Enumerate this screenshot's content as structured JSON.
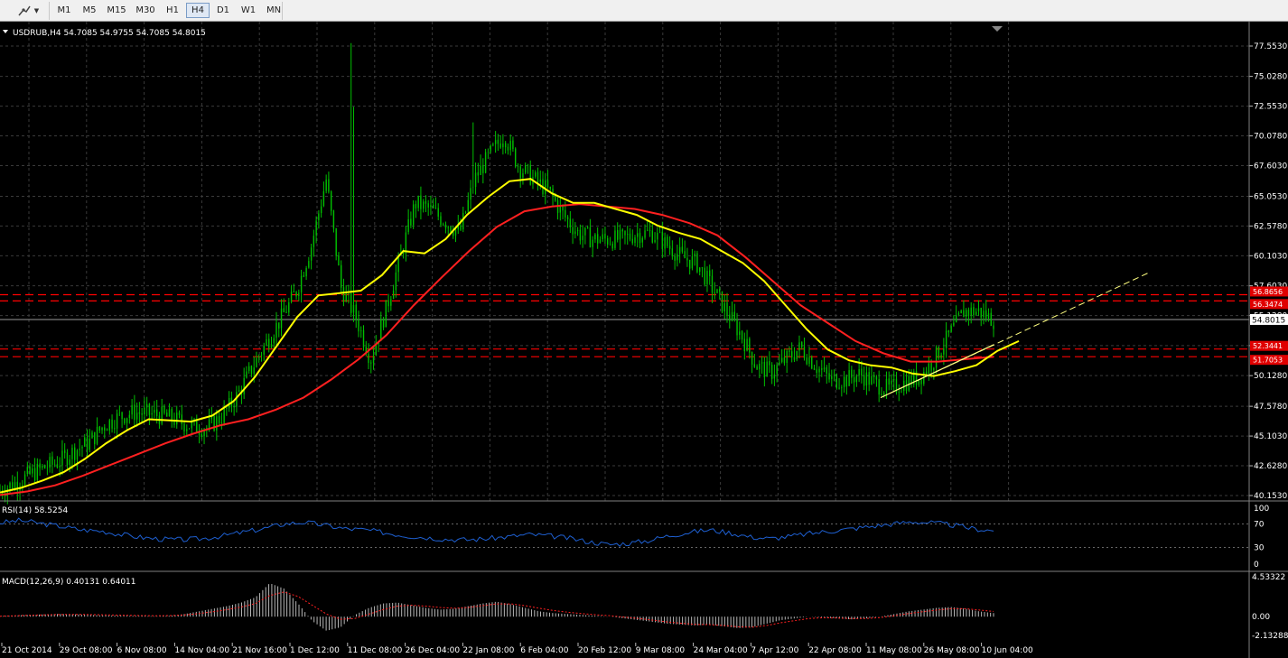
{
  "toolbar": {
    "tool_icon": "line-tool-icon",
    "timeframes": [
      {
        "label": "M1",
        "active": false
      },
      {
        "label": "M5",
        "active": false
      },
      {
        "label": "M15",
        "active": false
      },
      {
        "label": "M30",
        "active": false
      },
      {
        "label": "H1",
        "active": false
      },
      {
        "label": "H4",
        "active": true
      },
      {
        "label": "D1",
        "active": false
      },
      {
        "label": "W1",
        "active": false
      },
      {
        "label": "MN",
        "active": false
      }
    ]
  },
  "colors": {
    "background": "#000000",
    "grid": "#3a3a3a",
    "candles": "#00c000",
    "ma_fast": "#ffff00",
    "ma_slow": "#ff2020",
    "level_lines": "#ff0000",
    "rsi": "#1e5fd0",
    "macd_hist": "#b8b8b8",
    "macd_signal": "#ff2020",
    "trendline": "#ffff80"
  },
  "chart_data": [
    {
      "type": "candlestick",
      "title": "USDRUB,H4  54.7085 54.9755 54.7085 54.8015",
      "symbol": "USDRUB",
      "timeframe": "H4",
      "ohlc": {
        "open": 54.7085,
        "high": 54.9755,
        "low": 54.7085,
        "close": 54.8015
      },
      "ylim": [
        40.153,
        78.0
      ],
      "price_ticks": [
        "77.5530",
        "75.0280",
        "72.5530",
        "70.0780",
        "67.6030",
        "65.0530",
        "62.5780",
        "60.1030",
        "57.6030",
        "55.1280",
        "52.6280",
        "50.1280",
        "47.5780",
        "45.1030",
        "42.6280",
        "40.1530"
      ],
      "current_price": "54.8015",
      "levels": [
        {
          "price": 56.8656,
          "label": "56.8656"
        },
        {
          "price": 56.3474,
          "label": "56.3474"
        },
        {
          "price": 52.3441,
          "label": "52.3441"
        },
        {
          "price": 51.7053,
          "label": "51.7053"
        }
      ],
      "x_labels": [
        "21 Oct 2014",
        "29 Oct 08:00",
        "6 Nov 08:00",
        "14 Nov 04:00",
        "21 Nov 16:00",
        "1 Dec 12:00",
        "11 Dec 08:00",
        "26 Dec 04:00",
        "22 Jan 08:00",
        "6 Feb 04:00",
        "20 Feb 12:00",
        "9 Mar 08:00",
        "24 Mar 04:00",
        "7 Apr 12:00",
        "22 Apr 08:00",
        "11 May 08:00",
        "26 May 08:00",
        "10 Jun 04:00"
      ],
      "close_path": [
        40.6,
        41.2,
        41.9,
        42.5,
        43.0,
        43.9,
        44.6,
        46.0,
        46.7,
        47.1,
        47.0,
        46.8,
        46.4,
        45.9,
        45.8,
        46.8,
        48.5,
        50.8,
        53.0,
        55.0,
        57.2,
        61.0,
        66.5,
        57.5,
        55.0,
        51.5,
        55.5,
        60.0,
        64.5,
        64.0,
        63.0,
        62.0,
        66.5,
        68.5,
        70.2,
        67.5,
        66.5,
        65.5,
        63.5,
        62.0,
        61.5,
        61.5,
        61.5,
        62.0,
        62.0,
        61.0,
        60.0,
        59.5,
        57.5,
        55.5,
        53.5,
        51.0,
        50.4,
        51.5,
        52.5,
        51.0,
        49.8,
        49.8,
        50.3,
        49.5,
        49.0,
        49.6,
        50.0,
        51.5,
        53.5,
        55.5,
        55.5,
        54.8
      ],
      "ma_fast_path": [
        40.4,
        40.8,
        41.4,
        42.1,
        43.2,
        44.5,
        45.6,
        46.5,
        46.4,
        46.3,
        46.8,
        48.0,
        50.0,
        52.5,
        55.0,
        56.8,
        57.0,
        57.2,
        58.5,
        60.5,
        60.3,
        61.5,
        63.5,
        65.0,
        66.3,
        66.5,
        65.3,
        64.5,
        64.5,
        64.0,
        63.5,
        62.6,
        62.0,
        61.5,
        60.5,
        59.5,
        58.0,
        56.0,
        54.0,
        52.3,
        51.4,
        51.0,
        50.8,
        50.3,
        50.1,
        50.5,
        51.0,
        52.2,
        53.0
      ],
      "ma_slow_path": [
        40.2,
        40.5,
        41.0,
        41.8,
        42.7,
        43.6,
        44.5,
        45.3,
        46.0,
        46.5,
        47.3,
        48.3,
        49.8,
        51.5,
        53.5,
        56.0,
        58.3,
        60.5,
        62.5,
        63.8,
        64.2,
        64.4,
        64.2,
        64.0,
        63.5,
        62.8,
        61.8,
        60.0,
        58.0,
        56.0,
        54.5,
        53.0,
        52.0,
        51.3,
        51.3,
        51.5,
        51.7
      ]
    },
    {
      "type": "line",
      "title": "RSI(14) 58.5254",
      "ylim": [
        0,
        100
      ],
      "tick_labels": [
        "100",
        "70",
        "30",
        "0"
      ],
      "levels": [
        70,
        30
      ],
      "values": [
        72,
        76,
        71,
        66,
        60,
        58,
        52,
        47,
        44,
        43,
        45,
        50,
        56,
        62,
        70,
        73,
        68,
        62,
        60,
        55,
        50,
        47,
        44,
        43,
        45,
        48,
        52,
        50,
        46,
        40,
        35,
        37,
        42,
        50,
        56,
        60,
        55,
        48,
        45,
        49,
        54,
        58,
        62,
        66,
        70,
        74,
        72,
        68,
        62,
        58.5
      ]
    },
    {
      "type": "bar",
      "title": "MACD(12,26,9) 0.40131 0.64011",
      "ylim": [
        -2.13288,
        4.53322
      ],
      "tick_labels": [
        "4.53322",
        "0.00",
        "-2.13288"
      ],
      "values": [
        0.05,
        0.12,
        0.2,
        0.25,
        0.3,
        0.28,
        0.22,
        0.15,
        0.12,
        0.1,
        0.08,
        0.05,
        0.1,
        0.3,
        0.6,
        0.9,
        1.2,
        1.6,
        2.2,
        3.8,
        3.2,
        1.5,
        -0.5,
        -1.6,
        -1.2,
        0.2,
        1.0,
        1.5,
        1.6,
        1.3,
        1.0,
        0.8,
        0.9,
        1.2,
        1.5,
        1.7,
        1.4,
        1.0,
        0.6,
        0.4,
        0.3,
        0.2,
        0.1,
        0.0,
        -0.2,
        -0.4,
        -0.6,
        -0.8,
        -0.9,
        -1.0,
        -0.9,
        -1.1,
        -1.3,
        -1.2,
        -0.8,
        -0.4,
        -0.2,
        0.0,
        -0.1,
        -0.2,
        -0.3,
        -0.2,
        0.0,
        0.3,
        0.6,
        0.8,
        1.0,
        1.1,
        0.9,
        0.6,
        0.4
      ],
      "signal_values": [
        0.05,
        0.1,
        0.15,
        0.2,
        0.24,
        0.26,
        0.25,
        0.22,
        0.18,
        0.15,
        0.12,
        0.1,
        0.12,
        0.2,
        0.35,
        0.55,
        0.8,
        1.1,
        1.5,
        2.4,
        2.8,
        2.3,
        1.3,
        0.3,
        -0.3,
        -0.2,
        0.3,
        0.8,
        1.2,
        1.3,
        1.2,
        1.05,
        0.95,
        1.05,
        1.25,
        1.45,
        1.45,
        1.25,
        0.95,
        0.7,
        0.5,
        0.35,
        0.22,
        0.1,
        -0.05,
        -0.2,
        -0.4,
        -0.6,
        -0.75,
        -0.88,
        -0.9,
        -1.0,
        -1.15,
        -1.2,
        -1.0,
        -0.7,
        -0.45,
        -0.2,
        -0.12,
        -0.15,
        -0.22,
        -0.2,
        -0.1,
        0.1,
        0.35,
        0.55,
        0.75,
        0.9,
        0.9,
        0.75,
        0.6
      ]
    }
  ]
}
